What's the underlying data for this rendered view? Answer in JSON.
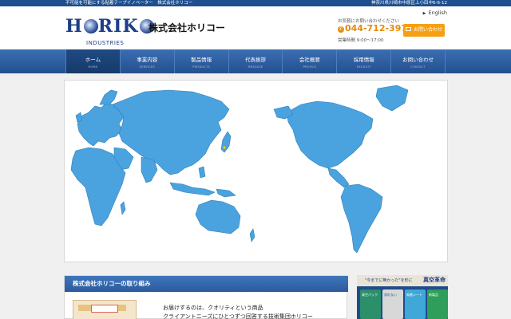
{
  "topbar": {
    "tagline": "不可能を可能にする粘着テープイノベーター　株式会社ホリコー",
    "address": "神奈川県川崎市中原区上小田中6-6-12"
  },
  "header": {
    "logo_word_part1": "H",
    "logo_word_part2": "RIK",
    "logo_sub": "INDUSTRIES",
    "company_name": "株式会社ホリコー",
    "english_link": "English",
    "contact_lead": "お気軽にお問い合わせください",
    "phone": "044-712-3971",
    "hours": "営業時間 9:00〜17:00",
    "inquiry_button": "お問い合わせ"
  },
  "nav": {
    "items": [
      {
        "jp": "ホーム",
        "en": "HOME"
      },
      {
        "jp": "事業内容",
        "en": "SERVICES"
      },
      {
        "jp": "製品情報",
        "en": "PRODUCTS"
      },
      {
        "jp": "代表挨拶",
        "en": "MESSAGE"
      },
      {
        "jp": "会社概要",
        "en": "PROFILE"
      },
      {
        "jp": "採用情報",
        "en": "RECRUIT"
      },
      {
        "jp": "お問い合わせ",
        "en": "CONTACT"
      }
    ]
  },
  "section": {
    "title": "株式会社ホリコーの取り組み",
    "line1": "お届けするのは、クオリティという商品",
    "line2": "クライアントニーズにひとつずつ回答する技術集団ホリコー"
  },
  "banner": {
    "tagline": "\"今までに無かった\"を形に",
    "brand": "真空革命",
    "packages": [
      "真空パック",
      "流れない",
      "吸着シート",
      "新製品"
    ]
  },
  "colors": {
    "brand_blue": "#1d4f8f",
    "nav_blue": "#3a6fb3",
    "accent_orange": "#f5a014",
    "map_land": "#4aa3df"
  },
  "icons": {
    "phone": "phone-icon",
    "mail": "mail-icon",
    "english_arrow": "triangle-right-icon"
  }
}
